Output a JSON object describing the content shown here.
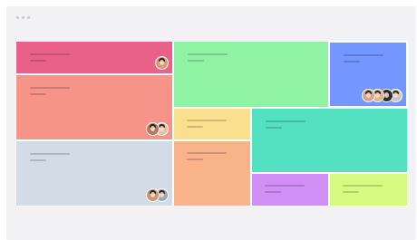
{
  "window_controls": {
    "icon": "window-dots-icon",
    "dots": 3,
    "color": "#c9c9cf"
  },
  "tiles": [
    {
      "id": "pink",
      "color": "#e96189",
      "avatars": [
        {
          "skin": "#d79b7a"
        }
      ]
    },
    {
      "id": "salmon",
      "color": "#f7948a",
      "avatars": [
        {
          "skin": "#e3c0a8"
        },
        {
          "skin": "#b27b5f"
        }
      ]
    },
    {
      "id": "gray-blue",
      "color": "#d3dce6",
      "avatars": [
        {
          "skin": "#9aa9b5"
        },
        {
          "skin": "#c9967a"
        }
      ]
    },
    {
      "id": "light-green",
      "color": "#90f3a4",
      "avatars": []
    },
    {
      "id": "blue",
      "color": "#7396ff",
      "selected": true,
      "avatars": [
        {
          "skin": "#c7c7c7"
        },
        {
          "skin": "#2e2e2e"
        },
        {
          "skin": "#e0b18f"
        },
        {
          "skin": "#d9a58a"
        }
      ]
    },
    {
      "id": "yellow",
      "color": "#f8e08e",
      "avatars": []
    },
    {
      "id": "peach",
      "color": "#f8b38a",
      "avatars": []
    },
    {
      "id": "teal",
      "color": "#54e1c2",
      "avatars": []
    },
    {
      "id": "purple",
      "color": "#d18ff5",
      "avatars": []
    },
    {
      "id": "lime",
      "color": "#d6f981",
      "avatars": []
    }
  ]
}
